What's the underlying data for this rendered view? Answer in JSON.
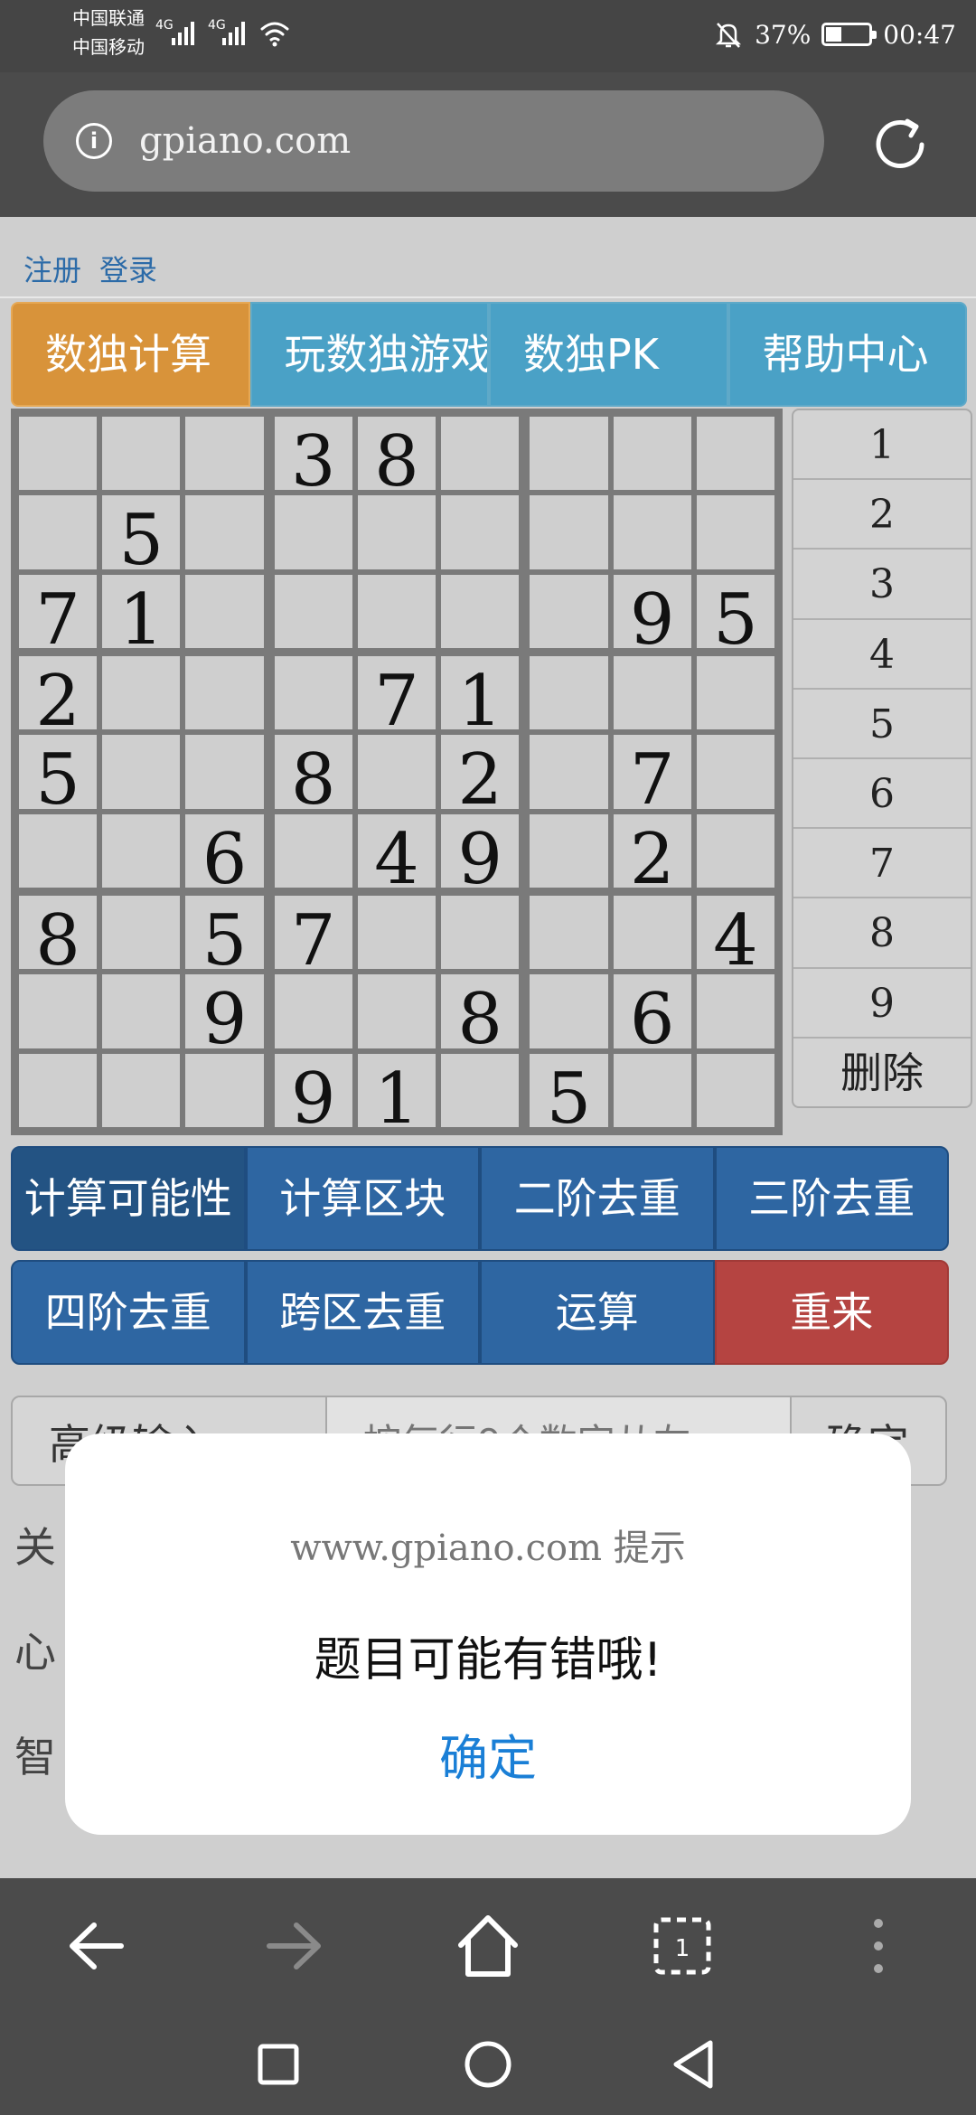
{
  "status_bar": {
    "carrier_1": "中国联通",
    "carrier_2": "中国移动",
    "network_1": "4G",
    "network_2": "4G",
    "battery_percent": "37%",
    "battery_level": 0.37,
    "time": "00:47",
    "icons": [
      "signal-icon",
      "wifi-icon",
      "mute-icon",
      "battery-icon"
    ]
  },
  "browser": {
    "url": "gpiano.com",
    "icons": [
      "info-icon",
      "refresh-icon"
    ]
  },
  "auth": {
    "register": "注册",
    "login": "登录"
  },
  "tabs": [
    {
      "label": "数独计算",
      "active": true
    },
    {
      "label": "玩数独游戏",
      "active": false
    },
    {
      "label": "数独PK",
      "active": false
    },
    {
      "label": "帮助中心",
      "active": false
    }
  ],
  "sudoku": {
    "grid": [
      [
        "",
        "",
        "",
        "3",
        "8",
        "",
        "",
        "",
        ""
      ],
      [
        "",
        "5",
        "",
        "",
        "",
        "",
        "",
        "",
        ""
      ],
      [
        "7",
        "1",
        "",
        "",
        "",
        "",
        "",
        "9",
        "5"
      ],
      [
        "2",
        "",
        "",
        "",
        "7",
        "1",
        "",
        "",
        ""
      ],
      [
        "5",
        "",
        "",
        "8",
        "",
        "2",
        "",
        "7",
        ""
      ],
      [
        "",
        "",
        "6",
        "",
        "4",
        "9",
        "",
        "2",
        ""
      ],
      [
        "8",
        "",
        "5",
        "7",
        "",
        "",
        "",
        "",
        "4"
      ],
      [
        "",
        "",
        "9",
        "",
        "",
        "8",
        "",
        "6",
        ""
      ],
      [
        "",
        "",
        "",
        "9",
        "1",
        "",
        "5",
        "",
        ""
      ]
    ]
  },
  "numpad": {
    "keys": [
      "1",
      "2",
      "3",
      "4",
      "5",
      "6",
      "7",
      "8",
      "9"
    ],
    "delete": "删除"
  },
  "actions": {
    "calc_possible": "计算可能性",
    "calc_block": "计算区块",
    "second_order": "二阶去重",
    "third_order": "三阶去重",
    "fourth_order": "四阶去重",
    "cross_region": "跨区去重",
    "run": "运算",
    "restart": "重来"
  },
  "advanced": {
    "label": "高级输入",
    "placeholder": "按每行9个数字从左",
    "confirm": "确定"
  },
  "side_text": [
    "关",
    "心",
    "智"
  ],
  "dialog": {
    "title": "www.gpiano.com 提示",
    "message": "题目可能有错哦!",
    "ok": "确定"
  },
  "browser_nav_icons": [
    "back-arrow-icon",
    "forward-arrow-icon",
    "home-icon",
    "tabs-icon",
    "more-icon"
  ],
  "tab_count": "1",
  "system_nav_icons": [
    "recents-square-icon",
    "home-circle-icon",
    "back-triangle-icon"
  ]
}
